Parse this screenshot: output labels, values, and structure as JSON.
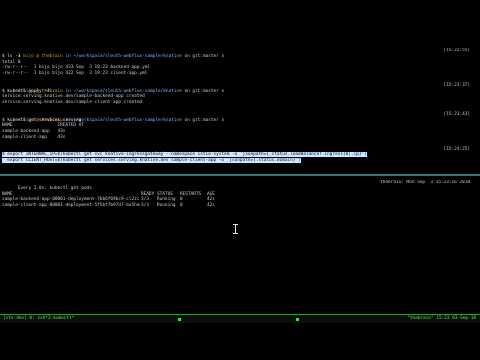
{
  "top": {
    "blocks": [
      {
        "user": "➜ bijo @ thebrain",
        "path": "in ~/workspace/sleuth-webflux-sample/knative",
        "git": "on git:master x",
        "time": "[15:22:55]",
        "cmd": "$ ls -1",
        "output": [
          "total 8",
          "-rw-r--r--  1 bijo bijo 433 Sep  3 19:23 backend-app.yml",
          "-rw-r--r--  1 bijo bijo 422 Sep  3 19:23 client-app.yml"
        ]
      },
      {
        "user": "➜ bijo @ thebrain",
        "path": "in ~/workspace/sleuth-webflux-sample/knative",
        "git": "on git:master x",
        "time": "[15:23:37]",
        "cmd": "$ kubectl apply -f .",
        "output": [
          "service.serving.knative.dev/sample-backend-app created",
          "service.serving.knative.dev/sample-client-app created"
        ]
      },
      {
        "user": "➜ bijo @ thebrain",
        "path": "in ~/workspace/sleuth-webflux-sample/knative",
        "git": "on git:master x",
        "time": "[15:23:43]",
        "cmd": "$ kubectl get services.serving",
        "output": [
          "NAME                 CREATED AT",
          "sample-backend-app   43s",
          "sample-client-app    43s"
        ]
      },
      {
        "user": "➜ bijo @ thebrain",
        "path": "in ~/workspace/sleuth-webflux-sample/knative",
        "git": "on git:master x",
        "time": "[15:24:25]",
        "cmd": "",
        "output": []
      }
    ],
    "selected_lines": [
      "$ export INTERNAL_IP=$(kubectl get svc knative-ingressgateway --namespace istio-system -o 'jsonpath={.status.loadBalancer.ingress[0].ip}')",
      "  export CLIENT_HOST=$(kubectl get services.serving.knative.dev sample-client-app -o 'jsonpath={.status.domain}')"
    ]
  },
  "bottom": {
    "header_left": "Every 2.0s: kubectl get pods",
    "header_right": "thebrain: Mon Sep  3 15:23:16 2018",
    "columns": [
      "NAME",
      "READY",
      "STATUS",
      "RESTARTS",
      "AGE"
    ],
    "rows": [
      [
        "sample-backend-app-00001-deployment-7bb6f69bc9-cl2zc",
        "3/3",
        "Running",
        "0",
        "42s"
      ],
      [
        "sample-client-app-00001-deployment-5f5bf7b97d7-bx5hm",
        "3/3",
        "Running",
        "0",
        "42s"
      ]
    ]
  },
  "statusbar": {
    "left": "[sts-dev] 0:  zsh*2:kubectl*",
    "right": "\"thebrain\" 15:23 03-Sep-18"
  },
  "colors": {
    "divider": "#2f7a7a",
    "selection": "#cfe6ff",
    "status_green": "#6fe06f"
  }
}
